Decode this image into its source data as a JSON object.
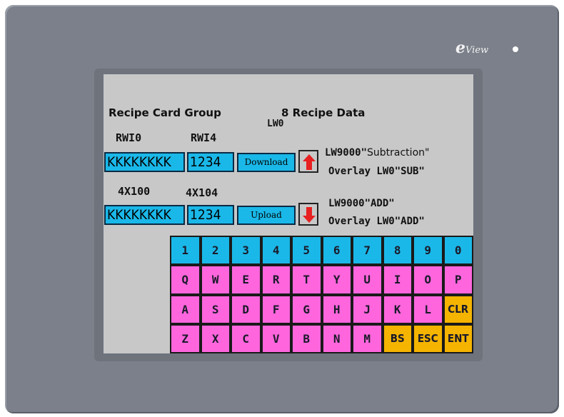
{
  "bezel": {
    "logo_e": "e",
    "logo_text": "View"
  },
  "screen": {
    "title_recipe_card_group": "Recipe Card Group",
    "title_recipe_data": "8 Recipe Data",
    "label_lw0": "LW0",
    "label_rwi0": "RWI0",
    "label_rwi4": "RWI4",
    "label_4x100": "4X100",
    "label_4x104": "4X104",
    "row1": {
      "text_value": "KKKKKKKK",
      "num_value": "1234",
      "button_label": "Download",
      "note_line1_prefix": "LW9000\"",
      "note_line1_plain": "Subtraction\"",
      "note_line2": "Overlay LW0\"SUB\""
    },
    "row2": {
      "text_value": "KKKKKKKK",
      "num_value": "1234",
      "button_label": "Upload",
      "note_line1": "LW9000\"ADD\"",
      "note_line2": "Overlay LW0\"ADD\""
    }
  },
  "keyboard": {
    "rows": [
      [
        "1",
        "2",
        "3",
        "4",
        "5",
        "6",
        "7",
        "8",
        "9",
        "0"
      ],
      [
        "Q",
        "W",
        "E",
        "R",
        "T",
        "Y",
        "U",
        "I",
        "O",
        "P"
      ],
      [
        "A",
        "S",
        "D",
        "F",
        "G",
        "H",
        "J",
        "K",
        "L",
        "CLR"
      ],
      [
        "Z",
        "X",
        "C",
        "V",
        "B",
        "N",
        "M",
        "BS",
        "ESC",
        "ENT"
      ]
    ],
    "colors": {
      "number_key": "#1ab8e8",
      "letter_key": "#ff66dd",
      "function_key": "#f5b400"
    }
  },
  "colors": {
    "bezel": "#7b808a",
    "screen_bg": "#c8c8c8",
    "field_bg": "#1ab8e8",
    "arrow_red": "#e82020"
  },
  "icons": {
    "up": "arrow-up-icon",
    "down": "arrow-down-icon"
  }
}
